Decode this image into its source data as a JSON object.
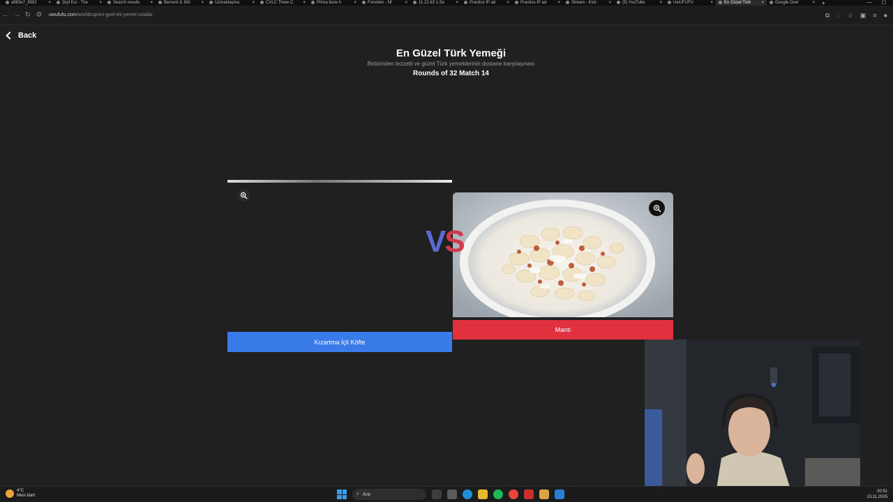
{
  "browser": {
    "tabs": [
      {
        "label": "a883e7_8592",
        "active": false
      },
      {
        "label": "Şişli Kız - The",
        "active": false
      },
      {
        "label": "Search results",
        "active": false
      },
      {
        "label": "Berserk 8. Böl",
        "active": false
      },
      {
        "label": "Uzmanlaşma",
        "active": false
      },
      {
        "label": "CVLC Three C",
        "active": false
      },
      {
        "label": "Prima facie h",
        "active": false
      },
      {
        "label": "Forsiden - Nf",
        "active": false
      },
      {
        "label": "11.22.63 1.Se",
        "active": false
      },
      {
        "label": "Practice IP ad",
        "active": false
      },
      {
        "label": "Practice IP ad",
        "active": false
      },
      {
        "label": "Stream - Kick",
        "active": false
      },
      {
        "label": "(5) YouTube",
        "active": false
      },
      {
        "label": "UwUFUFU",
        "active": false
      },
      {
        "label": "En Güzel Türk",
        "active": true
      },
      {
        "label": "Google Over",
        "active": false
      }
    ],
    "new_tab": "+",
    "url_domain": "uwufufu.com",
    "url_path": "/worldcup/en-gzel-trk-yemei-ustalar"
  },
  "page": {
    "back_label": "Back",
    "title": "En Güzel Türk Yemeği",
    "subtitle": "Birbirinden lezzetli ve güzel Türk yemeklerinin dostane karşılaşması",
    "rounds": "Rounds of 32 Match 14",
    "vs_v": "V",
    "vs_s": "S",
    "left_choice": "Kızartma İçli Köfte",
    "right_choice": "Mantı",
    "colors": {
      "left_button": "#3a7bea",
      "right_button": "#e1313f",
      "background": "#202020"
    }
  },
  "taskbar": {
    "weather_temp": "4°C",
    "weather_desc": "Mest klart",
    "search_placeholder": "Ara",
    "time": "20:51",
    "date": "13.11.2025"
  }
}
